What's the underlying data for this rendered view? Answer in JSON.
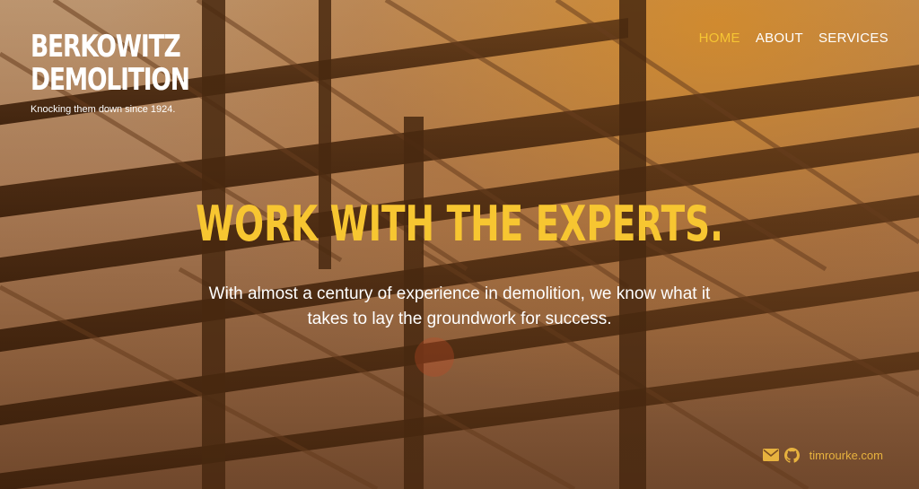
{
  "brand": {
    "line1": "BERKOWITZ",
    "line2": "DEMOLITION",
    "tagline": "Knocking them down since 1924."
  },
  "nav": {
    "items": [
      {
        "label": "HOME",
        "active": true
      },
      {
        "label": "ABOUT",
        "active": false
      },
      {
        "label": "SERVICES",
        "active": false
      }
    ]
  },
  "hero": {
    "headline": "WORK WITH THE EXPERTS.",
    "subtext": "With almost a century of experience in demolition, we know what it takes to lay the groundwork for success."
  },
  "footer": {
    "icons": [
      "mail-icon",
      "github-icon"
    ],
    "link_text": "timrourke.com"
  },
  "colors": {
    "accent": "#f7c631",
    "text": "#ffffff",
    "footer_link": "#e7b23e"
  }
}
